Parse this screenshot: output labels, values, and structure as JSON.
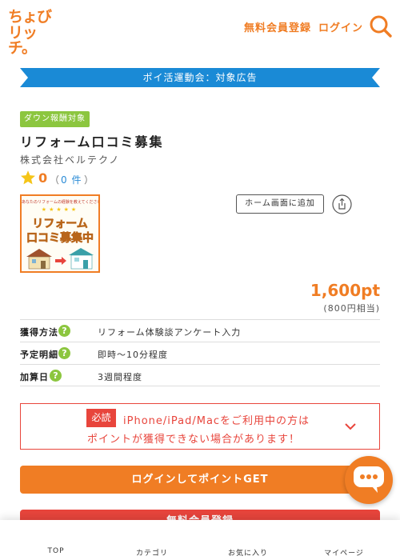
{
  "header": {
    "logo_line1": "ちょび",
    "logo_line2": "リッチ。",
    "signup_link": "無料会員登録",
    "login_link": "ログイン",
    "search_icon": "search-icon"
  },
  "campaign": {
    "ribbon_text": "ポイ活運動会：対象広告",
    "ribbon_color": "#1a8ad6"
  },
  "ad": {
    "badge": "ダウン報酬対象",
    "title": "リフォーム口コミ募集",
    "company": "株式会社ベルテクノ",
    "rating_score": "0",
    "rating_paren_open": "（",
    "rating_count": "0 件",
    "rating_paren_close": "）",
    "thumbnail": {
      "top_text": "あなたのリフォームの経験を教えてください",
      "stars": "★★★★★",
      "title_line1": "リフォーム",
      "title_line2": "口コミ募集中"
    },
    "home_add_button": "ホーム画面に追加",
    "points": "1,600pt",
    "points_yen": "(800円相当)"
  },
  "info": {
    "rows": [
      {
        "label": "獲得方法",
        "value": "リフォーム体験談アンケート入力"
      },
      {
        "label": "予定明細",
        "value": "即時～10分程度"
      },
      {
        "label": "加算日",
        "value": "3週間程度"
      }
    ],
    "help_glyph": "?"
  },
  "warning": {
    "tag": "必読",
    "line1": "iPhone/iPad/Macをご利用中の方は",
    "line2": "ポイントが獲得できない場合があります！"
  },
  "buttons": {
    "login_get": "ログインしてポイントGET",
    "free_signup": "無料会員登録"
  },
  "bottom_nav": {
    "items": [
      {
        "label": "TOP",
        "icon": "home-icon"
      },
      {
        "label": "カテゴリ",
        "icon": "category-icon"
      },
      {
        "label": "お気に入り",
        "icon": "favorite-icon"
      },
      {
        "label": "マイページ",
        "icon": "mypage-icon"
      }
    ]
  },
  "colors": {
    "brand_orange": "#f07d24",
    "badge_green": "#8cc63f",
    "alert_red": "#e8453c",
    "ribbon_blue": "#1a8ad6"
  }
}
